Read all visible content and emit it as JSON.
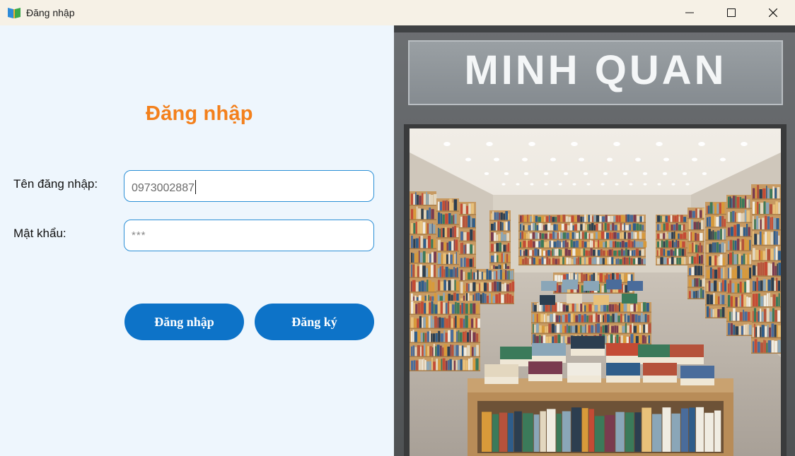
{
  "window": {
    "title": "Đăng nhập",
    "icon": "book-icon",
    "controls": [
      "minimize",
      "maximize",
      "close"
    ]
  },
  "login": {
    "heading": "Đăng nhập",
    "username_label": "Tên đăng nhập:",
    "username_value": "0973002887",
    "password_label": "Mật khẩu:",
    "password_value": "***",
    "login_button": "Đăng nhập",
    "register_button": "Đăng ký"
  },
  "store_image": {
    "sign_text": "MINH QUAN"
  },
  "colors": {
    "accent_orange": "#f3801c",
    "button_blue": "#0d73c8",
    "field_border": "#2b8fd6",
    "panel_bg": "#eef6fd"
  }
}
